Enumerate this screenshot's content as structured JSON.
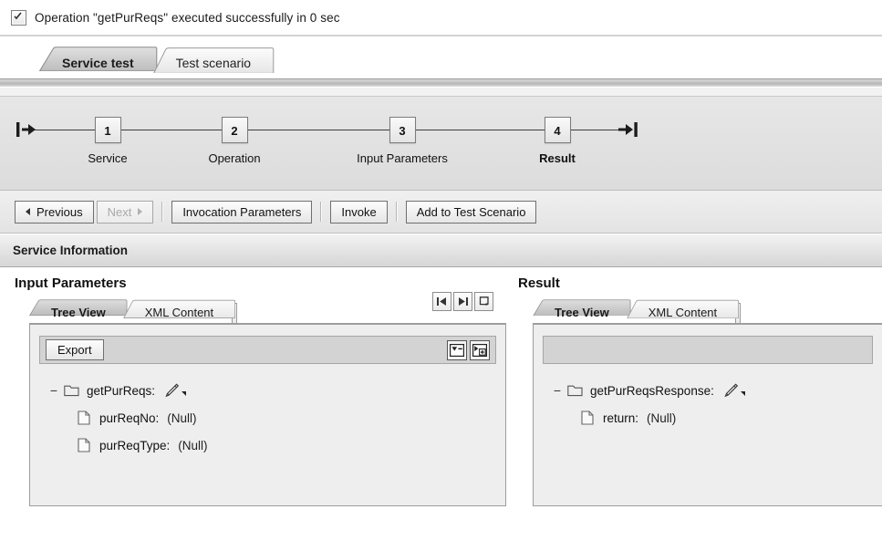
{
  "status": {
    "icon": "checkbox-checked-icon",
    "message": "Operation \"getPurReqs\" executed successfully in 0 sec"
  },
  "tabs": [
    {
      "label": "Service test",
      "active": true
    },
    {
      "label": "Test scenario",
      "active": false
    }
  ],
  "wizard": {
    "start_icon": "flow-start-icon",
    "end_icon": "flow-end-icon",
    "steps": [
      {
        "number": "1",
        "label": "Service",
        "current": false
      },
      {
        "number": "2",
        "label": "Operation",
        "current": false
      },
      {
        "number": "3",
        "label": "Input Parameters",
        "current": false
      },
      {
        "number": "4",
        "label": "Result",
        "current": true
      }
    ]
  },
  "toolbar": {
    "previous_label": "Previous",
    "previous_icon": "triangle-left-icon",
    "next_label": "Next",
    "next_icon": "triangle-right-icon",
    "next_disabled": true,
    "invocation_parameters_label": "Invocation Parameters",
    "invoke_label": "Invoke",
    "add_to_test_scenario_label": "Add to Test Scenario"
  },
  "section": {
    "service_information_label": "Service Information"
  },
  "middle_nav": [
    {
      "icon": "skip-to-start-icon"
    },
    {
      "icon": "skip-to-end-icon"
    },
    {
      "icon": "refresh-loop-icon"
    }
  ],
  "input_panel": {
    "title": "Input Parameters",
    "tabs": [
      {
        "label": "Tree View",
        "active": true
      },
      {
        "label": "XML Content",
        "active": false
      }
    ],
    "export_label": "Export",
    "collapse_icon": "collapse-all-icon",
    "expand_icon": "expand-all-icon",
    "tree": [
      {
        "level": 0,
        "toggle": "minus",
        "icon": "folder-icon",
        "label": "getPurReqs:",
        "value": "",
        "editable": true
      },
      {
        "level": 1,
        "toggle": "",
        "icon": "file-icon",
        "label": "purReqNo:",
        "value": "(Null)",
        "editable": false
      },
      {
        "level": 1,
        "toggle": "",
        "icon": "file-icon",
        "label": "purReqType:",
        "value": "(Null)",
        "editable": false
      }
    ]
  },
  "result_panel": {
    "title": "Result",
    "tabs": [
      {
        "label": "Tree View",
        "active": true
      },
      {
        "label": "XML Content",
        "active": false
      }
    ],
    "tree": [
      {
        "level": 0,
        "toggle": "minus",
        "icon": "folder-icon",
        "label": "getPurReqsResponse:",
        "value": "",
        "editable": true
      },
      {
        "level": 1,
        "toggle": "",
        "icon": "file-icon",
        "label": "return:",
        "value": "(Null)",
        "editable": false
      }
    ]
  },
  "colors": {
    "panel_background": "#eeeeee",
    "toolbar_background": "#e3e3e3",
    "tab_active": "#c8c8c8",
    "tab_inactive": "#e9e9e9",
    "border": "#9d9d9d",
    "text": "#111111"
  }
}
